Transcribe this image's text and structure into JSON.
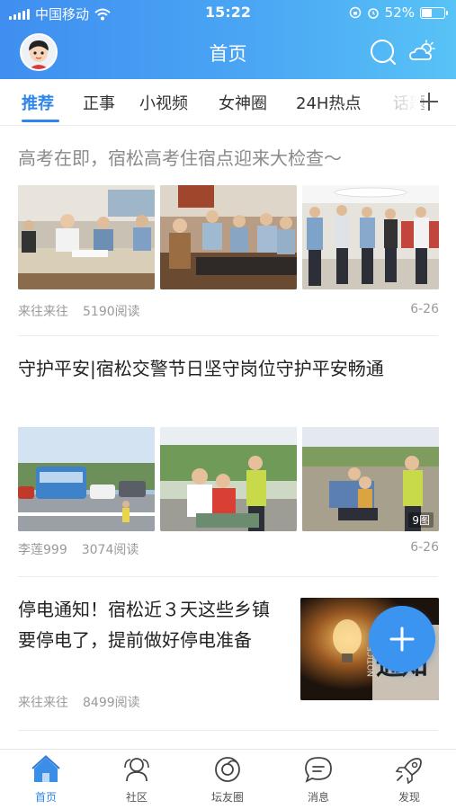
{
  "status_bar": {
    "carrier": "中国移动",
    "time": "15:22",
    "battery_pct": "52%",
    "battery_level": 0.52
  },
  "header": {
    "title": "首页",
    "icons": [
      "avatar",
      "search-icon",
      "weather-icon"
    ]
  },
  "tabs": [
    {
      "label": "推荐",
      "active": true
    },
    {
      "label": "正事"
    },
    {
      "label": "小视频"
    },
    {
      "label": "女神圈"
    },
    {
      "label": "24H热点"
    },
    {
      "label": "话题"
    }
  ],
  "articles": [
    {
      "title": "高考在即，宿松高考住宿点迎来大检查～",
      "author": "来往来往",
      "reads": "5190阅读",
      "date": "6-26",
      "images": 3
    },
    {
      "title": "守护平安|宿松交警节日坚守岗位守护平安畅通",
      "author": "李莲999",
      "reads": "3074阅读",
      "date": "6-26",
      "images": 3,
      "image_count_badge": "9图"
    },
    {
      "title": "停电通知！宿松近３天这些乡镇要停电了，提前做好停电准备",
      "author": "来往来往",
      "reads": "8499阅读",
      "thumbnail_text": "通知",
      "thumbnail_subtext": "NOTICE"
    }
  ],
  "fab": {
    "icon": "plus-icon"
  },
  "tab_bar": [
    {
      "label": "首页",
      "icon": "home-icon",
      "active": true
    },
    {
      "label": "社区",
      "icon": "community-icon"
    },
    {
      "label": "坛友圈",
      "icon": "circle-icon"
    },
    {
      "label": "消息",
      "icon": "message-icon"
    },
    {
      "label": "发现",
      "icon": "rocket-icon"
    }
  ],
  "colors": {
    "accent": "#2f86ea",
    "header_start": "#3f8ef0",
    "header_end": "#58c3f6"
  }
}
